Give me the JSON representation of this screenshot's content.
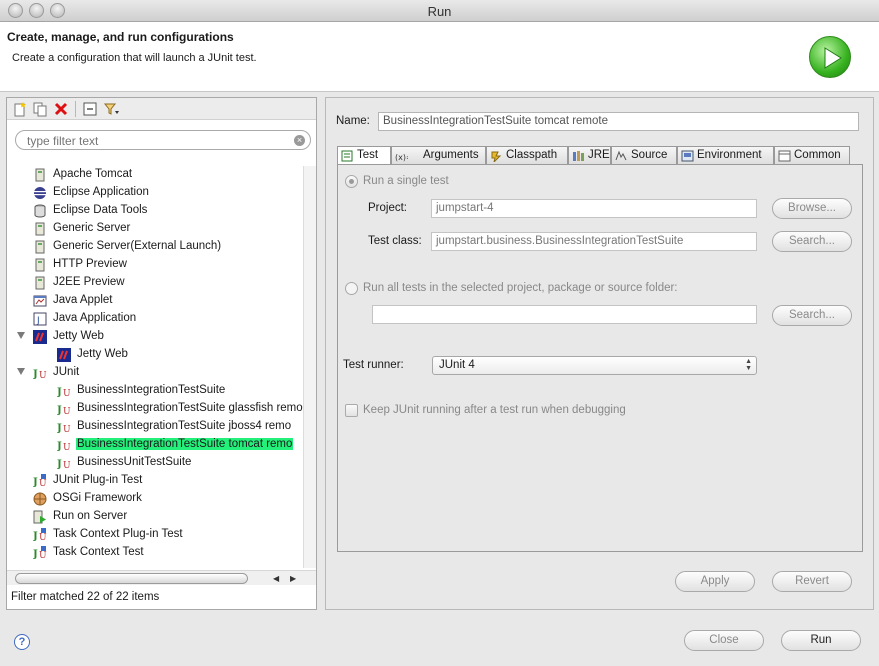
{
  "window": {
    "title": "Run"
  },
  "header": {
    "title": "Create, manage, and run configurations",
    "description": "Create a configuration that will launch a JUnit test."
  },
  "left_panel": {
    "filter_placeholder": "type filter text",
    "tree": [
      {
        "label": "Apache Tomcat",
        "icon": "server-icon"
      },
      {
        "label": "Eclipse Application",
        "icon": "eclipse-icon"
      },
      {
        "label": "Eclipse Data Tools",
        "icon": "database-icon"
      },
      {
        "label": "Generic Server",
        "icon": "server-icon"
      },
      {
        "label": "Generic Server(External Launch)",
        "icon": "server-icon"
      },
      {
        "label": "HTTP Preview",
        "icon": "server-icon"
      },
      {
        "label": "J2EE Preview",
        "icon": "server-icon"
      },
      {
        "label": "Java Applet",
        "icon": "applet-icon"
      },
      {
        "label": "Java Application",
        "icon": "java-app-icon"
      },
      {
        "label": "Jetty Web",
        "icon": "jetty-icon",
        "expanded": true
      },
      {
        "label": "Jetty Web",
        "icon": "jetty-icon"
      },
      {
        "label": "JUnit",
        "icon": "junit-icon",
        "expanded": true
      },
      {
        "label": "BusinessIntegrationTestSuite",
        "icon": "junit-icon"
      },
      {
        "label": "BusinessIntegrationTestSuite glassfish remo",
        "icon": "junit-icon"
      },
      {
        "label": "BusinessIntegrationTestSuite jboss4 remo",
        "icon": "junit-icon"
      },
      {
        "label": "BusinessIntegrationTestSuite tomcat remo",
        "icon": "junit-icon",
        "selected": true
      },
      {
        "label": "BusinessUnitTestSuite",
        "icon": "junit-icon"
      },
      {
        "label": "JUnit Plug-in Test",
        "icon": "junit-plugin-icon"
      },
      {
        "label": "OSGi Framework",
        "icon": "osgi-icon"
      },
      {
        "label": "Run on Server",
        "icon": "run-server-icon"
      },
      {
        "label": "Task Context Plug-in Test",
        "icon": "junit-plugin-icon"
      },
      {
        "label": "Task Context Test",
        "icon": "junit-plugin-icon"
      }
    ],
    "status": "Filter matched 22 of 22 items"
  },
  "config": {
    "name_label": "Name:",
    "name_value": "BusinessIntegrationTestSuite tomcat remote",
    "tabs": [
      {
        "label": "Test",
        "icon": "test-tab-icon",
        "active": true
      },
      {
        "label": "Arguments",
        "icon": "arguments-icon"
      },
      {
        "label": "Classpath",
        "icon": "classpath-icon"
      },
      {
        "label": "JRE",
        "icon": "jre-icon"
      },
      {
        "label": "Source",
        "icon": "source-icon"
      },
      {
        "label": "Environment",
        "icon": "environment-icon"
      },
      {
        "label": "Common",
        "icon": "common-icon"
      }
    ],
    "test_tab": {
      "single_test_label": "Run a single test",
      "project_label": "Project:",
      "project_value": "jumpstart-4",
      "browse_label": "Browse...",
      "test_class_label": "Test class:",
      "test_class_value": "jumpstart.business.BusinessIntegrationTestSuite",
      "search_label": "Search...",
      "all_tests_label": "Run all tests in the selected project, package or source folder:",
      "all_tests_value": "",
      "search2_label": "Search...",
      "runner_label": "Test runner:",
      "runner_value": "JUnit 4",
      "keep_running_label": "Keep JUnit running after a test run when debugging"
    },
    "apply_label": "Apply",
    "revert_label": "Revert"
  },
  "footer": {
    "help_label": "?",
    "close_label": "Close",
    "run_label": "Run"
  },
  "colors": {
    "selection": "#23f07a",
    "run_green": "#37b21f"
  }
}
